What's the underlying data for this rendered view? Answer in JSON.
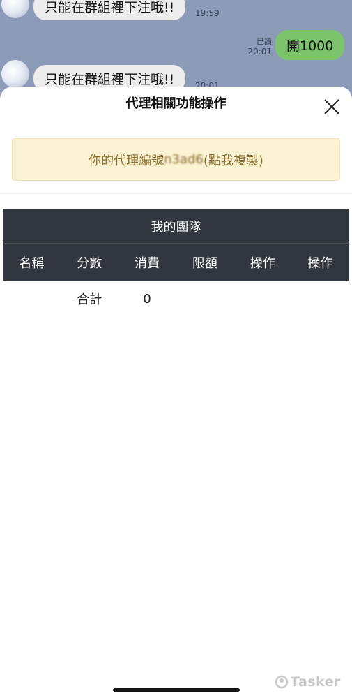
{
  "chat": {
    "messages": [
      {
        "text": "只能在群組裡下注哦!!",
        "time": "19:59"
      },
      {
        "text": "只能在群組裡下注哦!!",
        "time": "20:01"
      }
    ],
    "outgoing": {
      "text": "開1000",
      "read_label": "已讀",
      "time": "20:01"
    }
  },
  "sheet": {
    "title": "代理相關功能操作",
    "agent_prefix": "你的代理編號 ",
    "agent_code": "n3ad6",
    "agent_suffix": "(點我複製)",
    "team_title": "我的團隊",
    "columns": [
      "名稱",
      "分數",
      "消費",
      "限額",
      "操作",
      "操作"
    ],
    "total": {
      "label": "合計",
      "value": "0"
    }
  },
  "watermark": "Tasker",
  "colors": {
    "chat_bg": "#8c9cb8",
    "outgoing_bubble": "#7cc46b",
    "agent_box_bg": "#fbf3d4",
    "agent_box_text": "#8a6d2a",
    "table_header_bg": "#32373f"
  }
}
